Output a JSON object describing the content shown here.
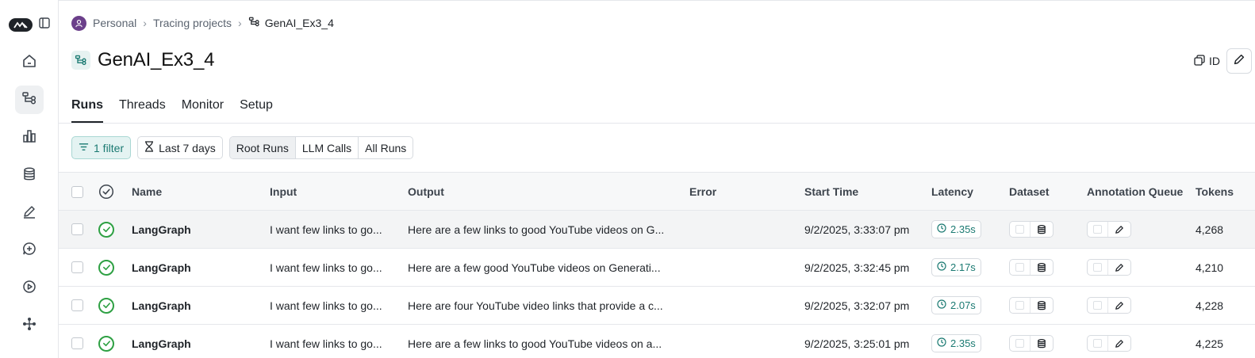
{
  "breadcrumb": {
    "workspace": "Personal",
    "section": "Tracing projects",
    "current": "GenAI_Ex3_4"
  },
  "page": {
    "title": "GenAI_Ex3_4",
    "id_label": "ID"
  },
  "tabs": [
    "Runs",
    "Threads",
    "Monitor",
    "Setup"
  ],
  "toolbar": {
    "filter_label": "1 filter",
    "time_range": "Last 7 days",
    "run_types": [
      "Root Runs",
      "LLM Calls",
      "All Runs"
    ],
    "active_run_type": "Root Runs"
  },
  "table": {
    "columns": {
      "name": "Name",
      "input": "Input",
      "output": "Output",
      "error": "Error",
      "start_time": "Start Time",
      "latency": "Latency",
      "dataset": "Dataset",
      "annotation_queue": "Annotation Queue",
      "tokens": "Tokens"
    },
    "rows": [
      {
        "name": "LangGraph",
        "input": "I want few links to go...",
        "output": "Here are a few links to good YouTube videos on G...",
        "error": "",
        "start_time": "9/2/2025, 3:33:07 pm",
        "latency": "2.35s",
        "tokens": "4,268",
        "status": "success"
      },
      {
        "name": "LangGraph",
        "input": "I want few links to go...",
        "output": "Here are a few good YouTube videos on Generati...",
        "error": "",
        "start_time": "9/2/2025, 3:32:45 pm",
        "latency": "2.17s",
        "tokens": "4,210",
        "status": "success"
      },
      {
        "name": "LangGraph",
        "input": "I want few links to go...",
        "output": "Here are four YouTube video links that provide a c...",
        "error": "",
        "start_time": "9/2/2025, 3:32:07 pm",
        "latency": "2.07s",
        "tokens": "4,228",
        "status": "success"
      },
      {
        "name": "LangGraph",
        "input": "I want few links to go...",
        "output": "Here are a few links to good YouTube videos on a...",
        "error": "",
        "start_time": "9/2/2025, 3:25:01 pm",
        "latency": "2.35s",
        "tokens": "4,225",
        "status": "success"
      }
    ]
  },
  "colors": {
    "accent": "#1b7a72",
    "success": "#2ea043",
    "avatar": "#6b3f8a"
  }
}
